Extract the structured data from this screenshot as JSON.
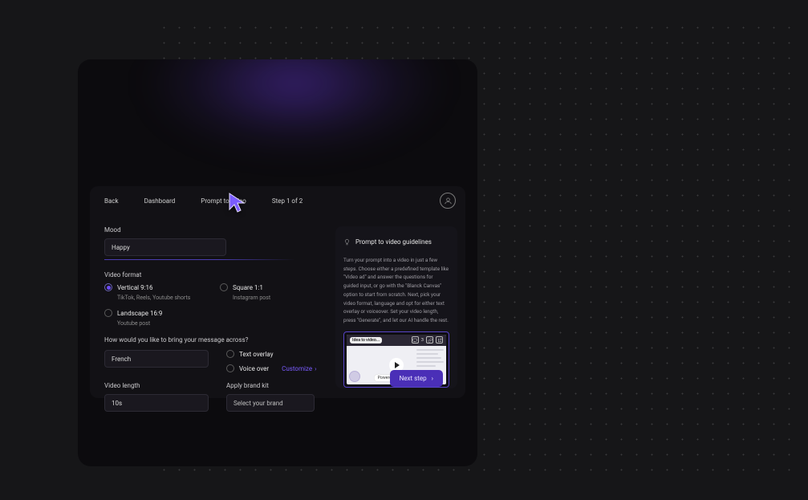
{
  "nav": {
    "back": "Back",
    "dashboard": "Dashboard",
    "prompt_to_video": "Prompt to video",
    "step": "Step 1 of 2"
  },
  "mood": {
    "label": "Mood",
    "value": "Happy"
  },
  "video_format": {
    "label": "Video format",
    "vertical": {
      "title": "Vertical 9:16",
      "sub": "TikTok, Reels, Youtube shorts",
      "selected": true
    },
    "square": {
      "title": "Square 1:1",
      "sub": "Instagram post",
      "selected": false
    },
    "landscape": {
      "title": "Landscape 16:9",
      "sub": "Youtube post",
      "selected": false
    }
  },
  "message_across": {
    "question": "How would you like to bring your message across?",
    "language_value": "French",
    "text_overlay": "Text overlay",
    "voice_over": "Voice over",
    "customize": "Customize"
  },
  "video_length": {
    "label": "Video length",
    "value": "10s"
  },
  "brand_kit": {
    "label": "Apply brand kit",
    "placeholder": "Select your brand"
  },
  "guidelines": {
    "title": "Prompt to video guidelines",
    "body": "Turn your prompt into a video in just a few steps. Choose either a predefined template like \"Video ad\" and answer the questions for guided input, or go with the \"Blanck Canvas\" option to start from scratch. Next, pick your video format, language and opt for either text overlay or voiceover. Set your video length, press \"Generate\", and let our AI handle the rest.",
    "thumb_title": "Idea to video...",
    "thumb_count": "3",
    "powered_by": "Powered by",
    "powered_brand": "icon"
  },
  "next_step": "Next step"
}
